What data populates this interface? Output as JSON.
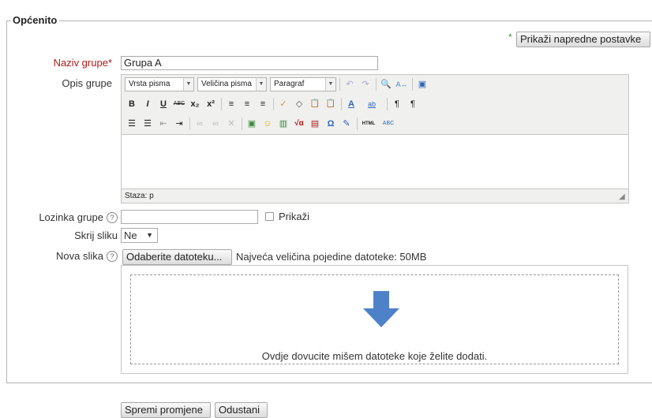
{
  "section": {
    "legend": "Općenito"
  },
  "advanced": {
    "star": "*",
    "label": "Prikaži napredne postavke"
  },
  "group_name": {
    "label": "Naziv grupe",
    "required_mark": "*",
    "value": "Grupa A"
  },
  "description": {
    "label": "Opis grupe",
    "toolbar": {
      "font_family": "Vrsta pisma",
      "font_size": "Veličina pisma",
      "format": "Paragraf",
      "row2": [
        "B",
        "I",
        "U",
        "ABC",
        "x₂",
        "x²",
        "≡",
        "≡",
        "≡",
        "✓",
        "◇",
        "📋",
        "📋",
        "A",
        "ab",
        "¶",
        "¶"
      ],
      "row3": [
        "☰",
        "☰",
        "⇤",
        "⇥",
        "∞",
        "∞",
        "✕",
        "▣",
        "☺",
        "▥",
        "√α",
        "▤",
        "Ω",
        "✎",
        "HTML",
        "ABC"
      ]
    },
    "status": "Staza: p"
  },
  "password": {
    "label": "Lozinka grupe",
    "help": "?",
    "show_label": "Prikaži",
    "value": ""
  },
  "hide_picture": {
    "label": "Skrij sliku",
    "selected": "Ne"
  },
  "new_picture": {
    "label": "Nova slika",
    "help": "?",
    "choose_button": "Odaberite datoteku...",
    "max_size": "Najveća veličina pojedine datoteke: 50MB",
    "drop_text": "Ovdje dovucite mišem datoteke koje želite dodati."
  },
  "actions": {
    "save": "Spremi promjene",
    "cancel": "Odustani"
  },
  "colors": {
    "required": "#b51a1a",
    "accent_arrow": "#4d82c9",
    "advanced_star": "#3a9a3a"
  }
}
